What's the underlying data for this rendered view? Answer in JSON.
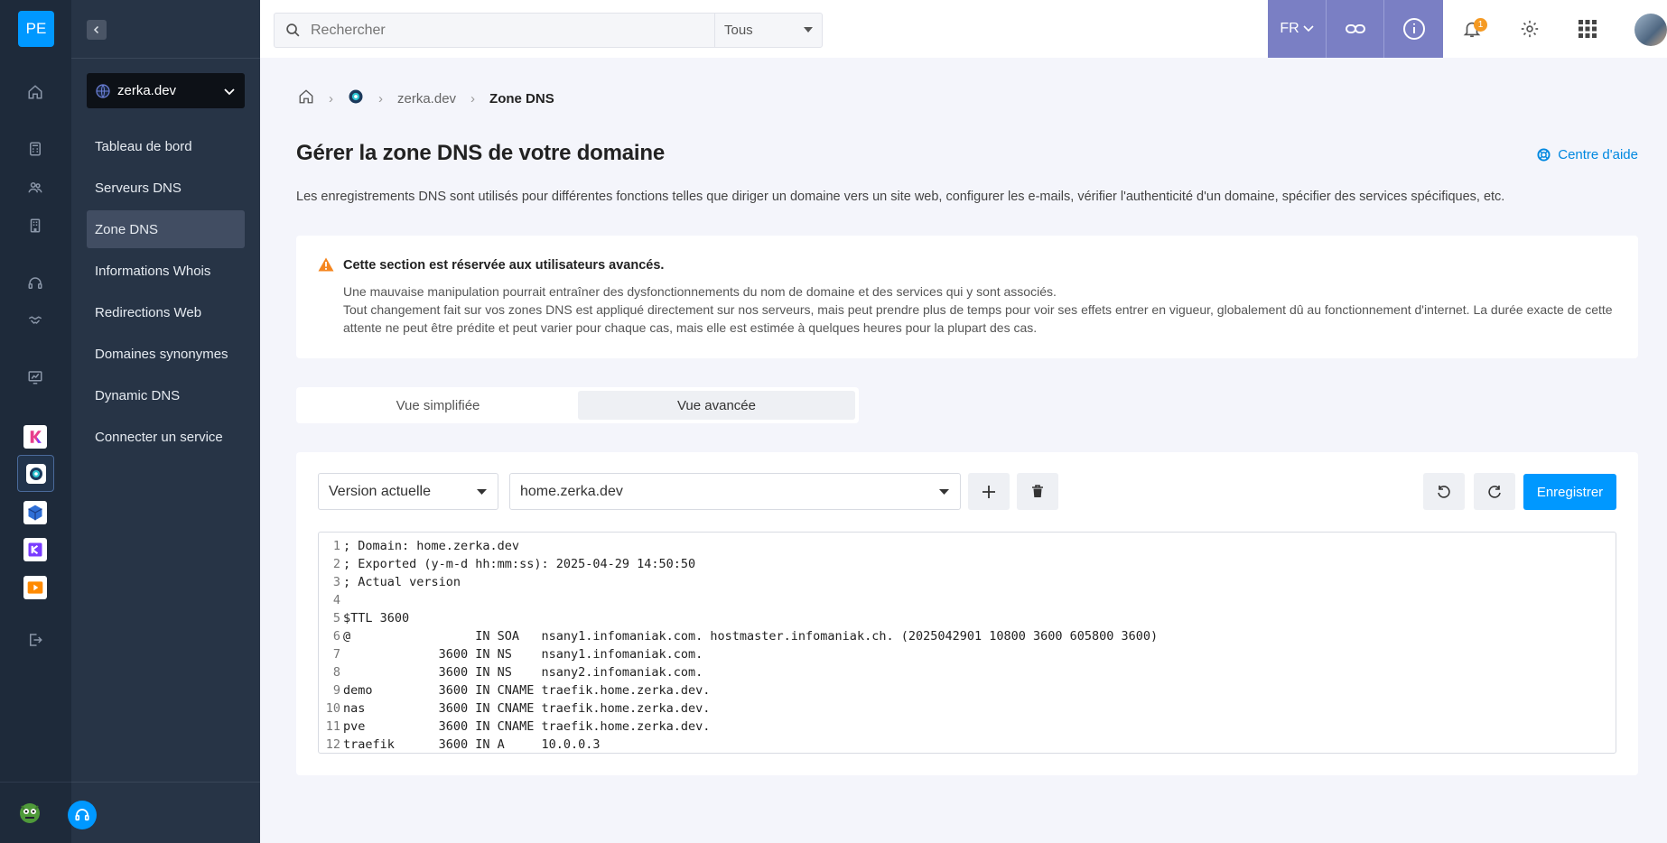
{
  "rail": {
    "logo": "PE",
    "icons": [
      "home-icon",
      "calculator-icon",
      "users-icon",
      "building-icon",
      "headset-icon",
      "handshake-icon",
      "dashboard-icon"
    ],
    "apps": [
      "kchat-app-icon",
      "domain-app-icon",
      "cube-app-icon",
      "kdrive-app-icon",
      "media-app-icon"
    ]
  },
  "sidebar": {
    "domain": "zerka.dev",
    "items": [
      {
        "label": "Tableau de bord"
      },
      {
        "label": "Serveurs DNS"
      },
      {
        "label": "Zone DNS",
        "active": true
      },
      {
        "label": "Informations Whois"
      },
      {
        "label": "Redirections Web"
      },
      {
        "label": "Domaines synonymes"
      },
      {
        "label": "Dynamic DNS"
      },
      {
        "label": "Connecter un service"
      }
    ]
  },
  "topbar": {
    "search_placeholder": "Rechercher",
    "scope": "Tous",
    "language": "FR",
    "notification_count": "1"
  },
  "breadcrumb": {
    "domain": "zerka.dev",
    "current": "Zone DNS"
  },
  "page": {
    "title": "Gérer la zone DNS de votre domaine",
    "help_link": "Centre d'aide",
    "description": "Les enregistrements DNS sont utilisés pour différentes fonctions telles que diriger un domaine vers un site web, configurer les e-mails, vérifier l'authenticité d'un domaine, spécifier des services spécifiques, etc."
  },
  "warning": {
    "title": "Cette section est réservée aux utilisateurs avancés.",
    "line1": "Une mauvaise manipulation pourrait entraîner des dysfonctionnements du nom de domaine et des services qui y sont associés.",
    "line2": "Tout changement fait sur vos zones DNS est appliqué directement sur nos serveurs, mais peut prendre plus de temps pour voir ses effets entrer en vigueur, globalement dû au fonctionnement d'internet. La durée exacte de cette attente ne peut être prédite et peut varier pour chaque cas, mais elle est estimée à quelques heures pour la plupart des cas."
  },
  "view_toggle": {
    "simple": "Vue simplifiée",
    "advanced": "Vue avancée"
  },
  "editor": {
    "version": "Version actuelle",
    "zone": "home.zerka.dev",
    "save_label": "Enregistrer",
    "lines": [
      {
        "n": "1",
        "text": "; Domain: home.zerka.dev"
      },
      {
        "n": "2",
        "text": "; Exported (y-m-d hh:mm:ss): 2025-04-29 14:50:50"
      },
      {
        "n": "3",
        "text": "; Actual version"
      },
      {
        "n": "4",
        "text": ""
      },
      {
        "n": "5",
        "text": "$TTL 3600"
      },
      {
        "n": "6",
        "text": "@                 IN SOA   nsany1.infomaniak.com. hostmaster.infomaniak.ch. (2025042901 10800 3600 605800 3600)"
      },
      {
        "n": "7",
        "text": "             3600 IN NS    nsany1.infomaniak.com."
      },
      {
        "n": "8",
        "text": "             3600 IN NS    nsany2.infomaniak.com."
      },
      {
        "n": "9",
        "text": "demo         3600 IN CNAME traefik.home.zerka.dev."
      },
      {
        "n": "10",
        "text": "nas          3600 IN CNAME traefik.home.zerka.dev."
      },
      {
        "n": "11",
        "text": "pve          3600 IN CNAME traefik.home.zerka.dev."
      },
      {
        "n": "12",
        "text": "traefik      3600 IN A     10.0.0.3"
      }
    ]
  }
}
